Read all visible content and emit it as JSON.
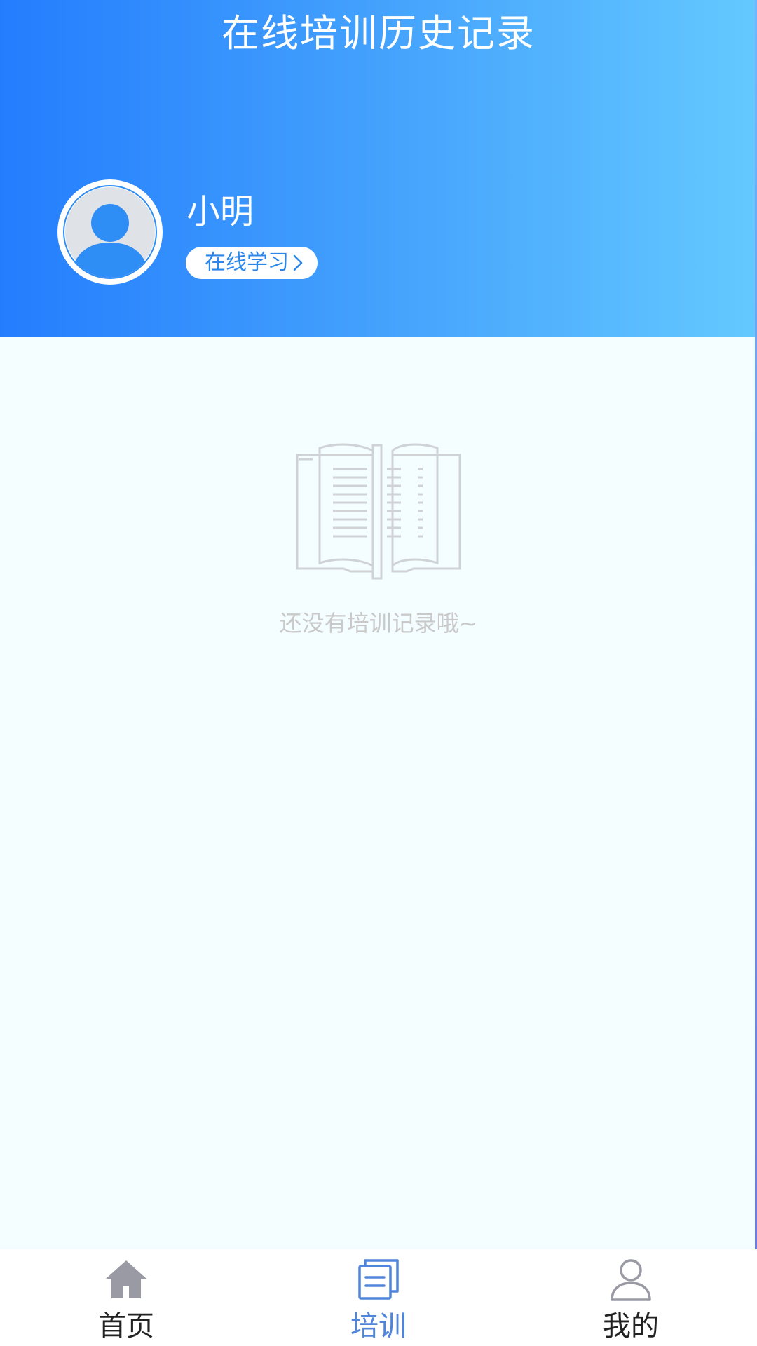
{
  "header": {
    "title": "在线培训历史记录",
    "user": {
      "name": "小明",
      "action_label": "在线学习"
    }
  },
  "empty_state": {
    "icon": "open-book-icon",
    "message": "还没有培训记录哦~"
  },
  "bottom_nav": {
    "items": [
      {
        "label": "首页",
        "icon": "home-icon",
        "active": false
      },
      {
        "label": "培训",
        "icon": "training-icon",
        "active": true
      },
      {
        "label": "我的",
        "icon": "profile-icon",
        "active": false
      }
    ]
  },
  "colors": {
    "header_gradient_start": "#247dfd",
    "header_gradient_end": "#64c9fe",
    "active_nav": "#4f85db",
    "inactive_nav_icon": "#999aa3",
    "empty_text": "#c9c9c9",
    "page_background": "#f4fdff"
  }
}
